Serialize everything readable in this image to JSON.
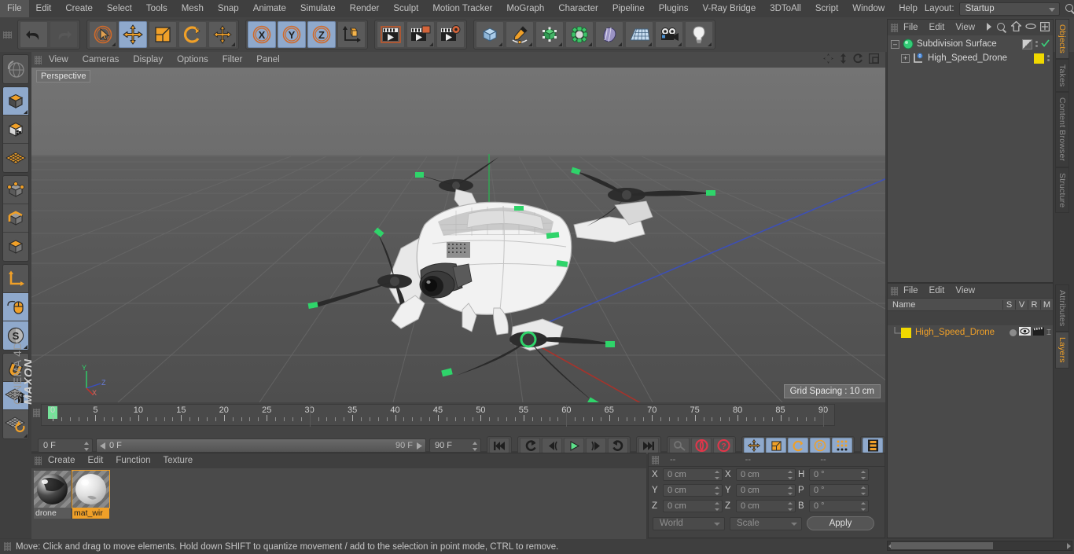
{
  "app": {
    "title": "MAXON CINEMA 4D",
    "brand_top": "MAXON",
    "brand_bottom": "CINEMA 4D"
  },
  "menubar": {
    "items": [
      "File",
      "Edit",
      "Create",
      "Select",
      "Tools",
      "Mesh",
      "Snap",
      "Animate",
      "Simulate",
      "Render",
      "Sculpt",
      "Motion Tracker",
      "MoGraph",
      "Character",
      "Pipeline",
      "Plugins",
      "V-Ray Bridge",
      "3DToAll",
      "Script",
      "Window",
      "Help"
    ],
    "layout_label": "Layout:",
    "layout_value": "Startup",
    "search_icon": "search-icon"
  },
  "toolbar": {
    "groups": [
      {
        "name": "undo-redo",
        "buttons": [
          {
            "icon": "undo-icon",
            "label": "Undo",
            "state": "normal"
          },
          {
            "icon": "redo-icon",
            "label": "Redo",
            "state": "disabled"
          }
        ]
      },
      {
        "name": "transform-tools",
        "buttons": [
          {
            "icon": "select-live-icon",
            "label": "Live Selection",
            "state": "normal"
          },
          {
            "icon": "move-icon",
            "label": "Move",
            "state": "selected"
          },
          {
            "icon": "scale-icon",
            "label": "Scale",
            "state": "normal"
          },
          {
            "icon": "rotate-icon",
            "label": "Rotate",
            "state": "normal"
          },
          {
            "icon": "move-axis-icon",
            "label": "Move Axis",
            "state": "normal"
          }
        ]
      },
      {
        "name": "axis-locks",
        "buttons": [
          {
            "icon": "x-axis-icon",
            "label": "X",
            "state": "selected"
          },
          {
            "icon": "y-axis-icon",
            "label": "Y",
            "state": "selected"
          },
          {
            "icon": "z-axis-icon",
            "label": "Z",
            "state": "selected"
          },
          {
            "icon": "world-object-axis-icon",
            "label": "World/Object",
            "state": "normal"
          }
        ]
      },
      {
        "name": "render-tools",
        "buttons": [
          {
            "icon": "render-view-icon",
            "label": "Render View",
            "state": "normal"
          },
          {
            "icon": "render-region-icon",
            "label": "Render to Picture Viewer",
            "state": "normal"
          },
          {
            "icon": "render-settings-icon",
            "label": "Edit Render Settings",
            "state": "normal"
          }
        ]
      },
      {
        "name": "create-objects",
        "buttons": [
          {
            "icon": "cube-icon",
            "label": "Add Cube Object",
            "state": "normal"
          },
          {
            "icon": "spline-pen-icon",
            "label": "Add Spline",
            "state": "normal"
          },
          {
            "icon": "generator-icon",
            "label": "Add Generator",
            "state": "normal"
          },
          {
            "icon": "deformer-icon",
            "label": "Add Deformer",
            "state": "normal"
          },
          {
            "icon": "scene-object-icon",
            "label": "Add Scene Object",
            "state": "normal"
          },
          {
            "icon": "environment-icon",
            "label": "Add Environment",
            "state": "normal"
          },
          {
            "icon": "camera-icon",
            "label": "Add Camera",
            "state": "normal"
          },
          {
            "icon": "light-icon",
            "label": "Add Light",
            "state": "normal"
          }
        ]
      }
    ]
  },
  "leftbar": {
    "items": [
      {
        "icon": "undo-view-icon",
        "label": "Undo View",
        "state": "normal"
      },
      {
        "icon": "model-mode-icon",
        "label": "Model Mode",
        "state": "selected"
      },
      {
        "icon": "texture-mode-icon",
        "label": "Texture Mode",
        "state": "normal"
      },
      {
        "icon": "workplane-mode-icon",
        "label": "Workplane Mode",
        "state": "normal"
      },
      {
        "icon": "points-mode-icon",
        "label": "Points Mode",
        "state": "normal"
      },
      {
        "icon": "edges-mode-icon",
        "label": "Edges Mode",
        "state": "normal"
      },
      {
        "icon": "polygons-mode-icon",
        "label": "Polygons Mode",
        "state": "normal"
      },
      {
        "icon": "object-axis-icon",
        "label": "Enable Axis",
        "state": "normal"
      },
      {
        "icon": "viewport-solo-icon",
        "label": "Viewport Solo",
        "state": "selected"
      },
      {
        "icon": "soft-selection-icon",
        "label": "Soft Selection",
        "state": "selected"
      },
      {
        "icon": "magnet-icon",
        "label": "Snap",
        "state": "normal"
      },
      {
        "icon": "workplane-lock-icon",
        "label": "Lock Workplane",
        "state": "selected"
      },
      {
        "icon": "workplane-rotate-icon",
        "label": "Rotate Workplane",
        "state": "normal"
      }
    ]
  },
  "viewport": {
    "menu": [
      "View",
      "Cameras",
      "Display",
      "Options",
      "Filter",
      "Panel"
    ],
    "view_label": "Perspective",
    "grid_spacing": "Grid Spacing : 10 cm",
    "axis_labels": {
      "x": "X",
      "y": "Y",
      "z": "Z"
    },
    "corner_icons": [
      "viewport-move-icon",
      "viewport-zoom-icon",
      "viewport-rotate-icon",
      "viewport-maximize-icon"
    ]
  },
  "timeline": {
    "ticks": [
      {
        "label": "0",
        "frame": 0
      },
      {
        "label": "5",
        "frame": 5
      },
      {
        "label": "10",
        "frame": 10
      },
      {
        "label": "15",
        "frame": 15
      },
      {
        "label": "20",
        "frame": 20
      },
      {
        "label": "25",
        "frame": 25
      },
      {
        "label": "30",
        "frame": 30
      },
      {
        "label": "35",
        "frame": 35
      },
      {
        "label": "40",
        "frame": 40
      },
      {
        "label": "45",
        "frame": 45
      },
      {
        "label": "50",
        "frame": 50
      },
      {
        "label": "55",
        "frame": 55
      },
      {
        "label": "60",
        "frame": 60
      },
      {
        "label": "65",
        "frame": 65
      },
      {
        "label": "70",
        "frame": 70
      },
      {
        "label": "75",
        "frame": 75
      },
      {
        "label": "80",
        "frame": 80
      },
      {
        "label": "85",
        "frame": 85
      },
      {
        "label": "90",
        "frame": 90
      }
    ],
    "range_min": 0,
    "range_max": 90,
    "current_frame_field": "0 F",
    "scrub_start": "0 F",
    "scrub_end": "90 F",
    "end_frame_field": "90 F",
    "preview_frame_field": "0 F",
    "transport": [
      {
        "icon": "go-to-start-icon",
        "label": "Go to Start"
      },
      {
        "icon": "previous-key-icon",
        "label": "Go to Previous Key"
      },
      {
        "icon": "step-back-icon",
        "label": "Go to Previous Frame"
      },
      {
        "icon": "play-icon",
        "label": "Play Forwards"
      },
      {
        "icon": "step-forward-icon",
        "label": "Go to Next Frame"
      },
      {
        "icon": "next-key-icon",
        "label": "Go to Next Key"
      },
      {
        "icon": "go-to-end-icon",
        "label": "Go to End"
      }
    ],
    "record_tools": [
      {
        "icon": "autokey-icon",
        "label": "Autokeying",
        "state": "disabled"
      },
      {
        "icon": "record-icon",
        "label": "Record Active Objects",
        "state": "normal"
      },
      {
        "icon": "keyframe-help-icon",
        "label": "Keyframe Selection",
        "state": "normal"
      }
    ],
    "key_toggles": [
      {
        "icon": "key-position-icon",
        "label": "Position",
        "state": "selected"
      },
      {
        "icon": "key-scale-icon",
        "label": "Scale",
        "state": "selected"
      },
      {
        "icon": "key-rotation-icon",
        "label": "Rotation",
        "state": "selected"
      },
      {
        "icon": "key-param-icon",
        "label": "Parameter",
        "state": "selected"
      },
      {
        "icon": "key-pla-icon",
        "label": "Point Level Animation",
        "state": "selected"
      }
    ],
    "timeline_toggle": {
      "icon": "timeline-icon",
      "label": "Animation Layers",
      "state": "selected"
    }
  },
  "materials": {
    "menu": [
      "Create",
      "Edit",
      "Function",
      "Texture"
    ],
    "items": [
      {
        "name": "drone",
        "selected": false,
        "thumb": "sphere-dark-icon"
      },
      {
        "name": "mat_wir",
        "selected": true,
        "thumb": "sphere-white-icon"
      }
    ]
  },
  "coordinates": {
    "headers": [
      "--",
      "--",
      "--"
    ],
    "position": {
      "label_x": "X",
      "x": "0 cm",
      "label_y": "Y",
      "y": "0 cm",
      "label_z": "Z",
      "z": "0 cm"
    },
    "size": {
      "label_x": "X",
      "x": "0 cm",
      "label_y": "Y",
      "y": "0 cm",
      "label_z": "Z",
      "z": "0 cm"
    },
    "rotation": {
      "label_h": "H",
      "h": "0 °",
      "label_p": "P",
      "p": "0 °",
      "label_b": "B",
      "b": "0 °"
    },
    "coord_system": "World",
    "size_mode": "Scale",
    "apply_label": "Apply"
  },
  "objects_panel": {
    "menu": [
      "File",
      "Edit",
      "View"
    ],
    "tools": [
      "chevron-right-icon",
      "search-icon",
      "home-icon",
      "ellipse-icon",
      "frame-icon"
    ],
    "tree": [
      {
        "name": "Subdivision Surface",
        "depth": 0,
        "icon": "subdivision-surface-icon",
        "expander": "minus",
        "swatch": "gradient",
        "check": true
      },
      {
        "name": "High_Speed_Drone",
        "depth": 1,
        "icon": "layer-object-icon",
        "expander": "plus",
        "swatch": "#f0d800",
        "check": false
      }
    ],
    "tabs": [
      {
        "label": "Objects",
        "active": true
      },
      {
        "label": "Takes",
        "active": false
      },
      {
        "label": "Content Browser",
        "active": false
      },
      {
        "label": "Structure",
        "active": false
      }
    ]
  },
  "attributes_panel": {
    "menu": [
      "File",
      "Edit",
      "View"
    ],
    "headers": {
      "name": "Name",
      "cols": [
        "S",
        "V",
        "R",
        "M"
      ]
    },
    "rows": [
      {
        "name": "High_Speed_Drone",
        "swatch": "#f0d800",
        "solo": "dot",
        "view": "eye-icon",
        "render": "render-icon"
      }
    ],
    "tabs": [
      {
        "label": "Attributes",
        "active": false
      },
      {
        "label": "Layers",
        "active": true
      }
    ]
  },
  "status": {
    "text": "Move: Click and drag to move elements. Hold down SHIFT to quantize movement / add to the selection in point mode, CTRL to remove."
  },
  "colors": {
    "accent_orange": "#f0a028",
    "selection_blue": "#8fa9cc",
    "panel_bg": "#424242",
    "toolbar_bg": "#444444",
    "viewport_bg": "#5d5d5d",
    "green_axis": "#33c06a",
    "red_axis": "#c0392b",
    "blue_axis": "#3a4fc0"
  }
}
